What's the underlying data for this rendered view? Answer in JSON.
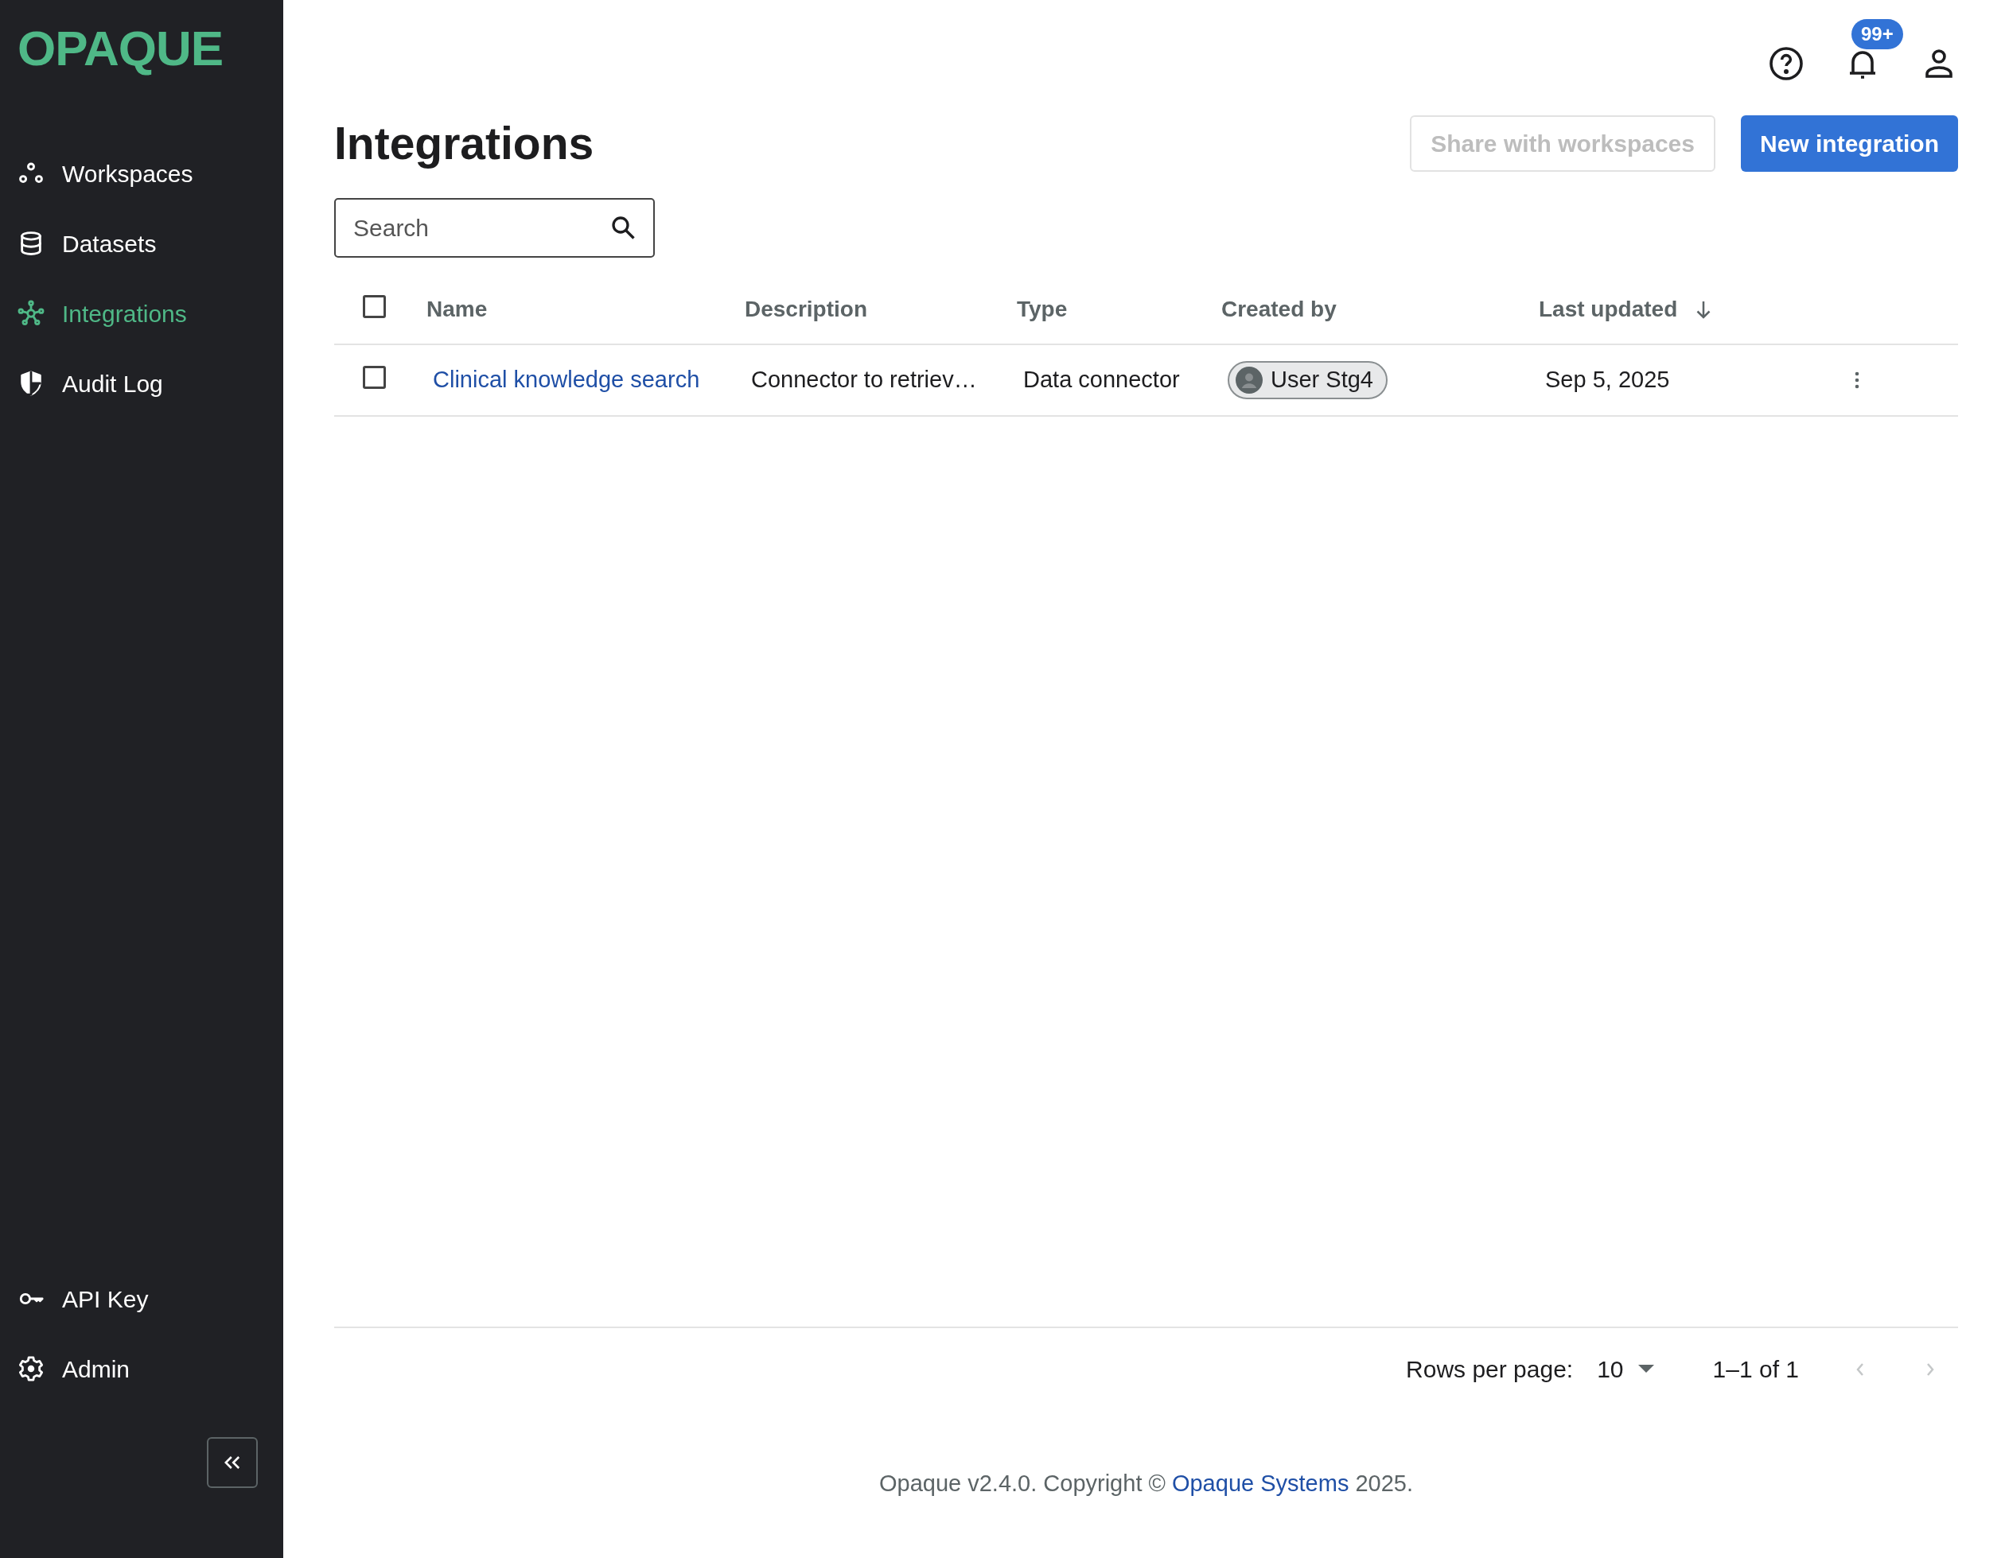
{
  "sidebar": {
    "logo": "OPAQUE",
    "items": [
      {
        "label": "Workspaces",
        "selected": false
      },
      {
        "label": "Datasets",
        "selected": false
      },
      {
        "label": "Integrations",
        "selected": true
      },
      {
        "label": "Audit Log",
        "selected": false
      }
    ],
    "bottom_items": [
      {
        "label": "API Key",
        "selected": false
      },
      {
        "label": "Admin",
        "selected": false
      }
    ]
  },
  "header": {
    "notifications_badge": "99+"
  },
  "page": {
    "title": "Integrations",
    "buttons": [
      {
        "label": "Share with workspaces",
        "disabled": true
      },
      {
        "label": "New integration",
        "disabled": false
      }
    ],
    "search": {
      "placeholder": "Search"
    }
  },
  "table": {
    "select_all_checked": false,
    "columns": [
      {
        "label": "Name",
        "sorted": false
      },
      {
        "label": "Description",
        "sorted": false
      },
      {
        "label": "Type",
        "sorted": false
      },
      {
        "label": "Created by",
        "sorted": false
      },
      {
        "label": "Last updated",
        "sorted": true
      }
    ],
    "rows": [
      {
        "checked": false,
        "name": "Clinical knowledge search",
        "description": "Connector to retriev…",
        "type": "Data connector",
        "created_by": "User Stg4",
        "last_updated": "Sep 5, 2025"
      }
    ]
  },
  "pagination": {
    "rows_per_page_label": "Rows per page:",
    "rows_per_page": "10",
    "range": "1–1 of 1"
  },
  "footer": {
    "prefix": "Opaque v2.4.0. Copyright ©",
    "link": "Opaque Systems",
    "suffix": "2025."
  }
}
